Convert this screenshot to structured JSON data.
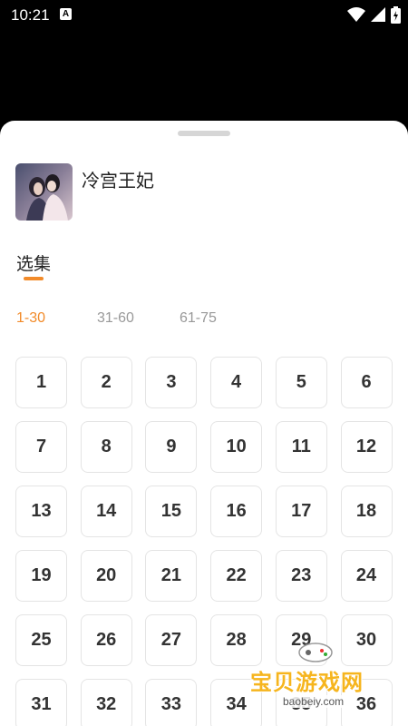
{
  "status_bar": {
    "time": "10:21",
    "notification_letter": "A",
    "icons": [
      "wifi-icon",
      "signal-icon",
      "battery-icon"
    ]
  },
  "drama": {
    "title": "冷宫王妃"
  },
  "episodes_section": {
    "title": "选集",
    "ranges": [
      "1-30",
      "31-60",
      "61-75"
    ],
    "active_range": "1-30",
    "episodes": [
      "1",
      "2",
      "3",
      "4",
      "5",
      "6",
      "7",
      "8",
      "9",
      "10",
      "11",
      "12",
      "13",
      "14",
      "15",
      "16",
      "17",
      "18",
      "19",
      "20",
      "21",
      "22",
      "23",
      "24",
      "25",
      "26",
      "27",
      "28",
      "29",
      "30",
      "31",
      "32",
      "33",
      "34",
      "35",
      "36"
    ]
  },
  "watermark": {
    "text": "宝贝游戏网",
    "url": "baobeiy.com"
  },
  "colors": {
    "accent": "#f28b2a",
    "tile_border": "#e4e4e4",
    "inactive_tab": "#999999"
  }
}
